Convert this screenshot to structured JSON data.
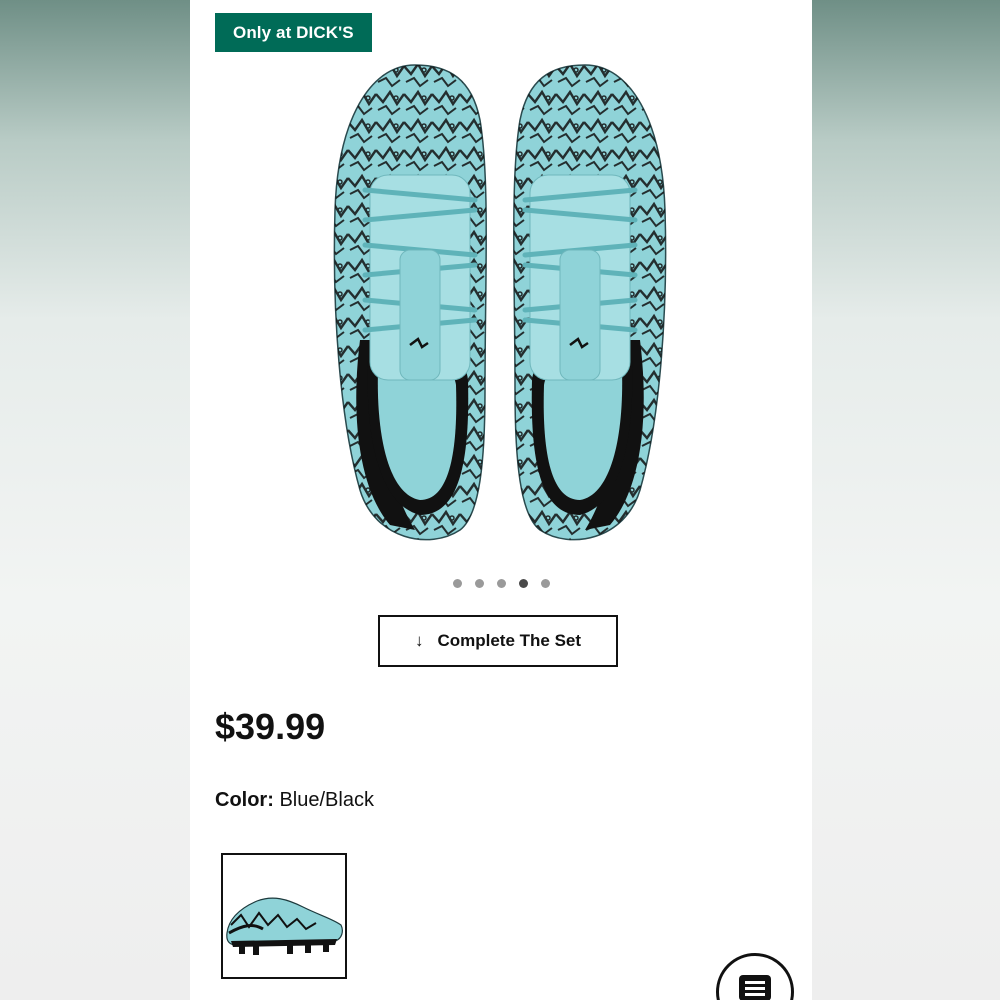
{
  "badge": {
    "label": "Only at DICK'S",
    "color": "#006b57"
  },
  "product": {
    "image_icon": "cleats-top-view-image",
    "colors": {
      "upper": "#8fd3d8",
      "pattern": "#111111"
    }
  },
  "carousel": {
    "count": 5,
    "active_index": 4
  },
  "complete_set": {
    "label": "Complete The Set",
    "icon": "arrow-down-icon"
  },
  "price": "$39.99",
  "color_selector": {
    "label": "Color:",
    "value": "Blue/Black"
  },
  "swatches": [
    {
      "name": "Blue/Black",
      "selected": true
    }
  ],
  "chat": {
    "icon": "chat-icon"
  }
}
